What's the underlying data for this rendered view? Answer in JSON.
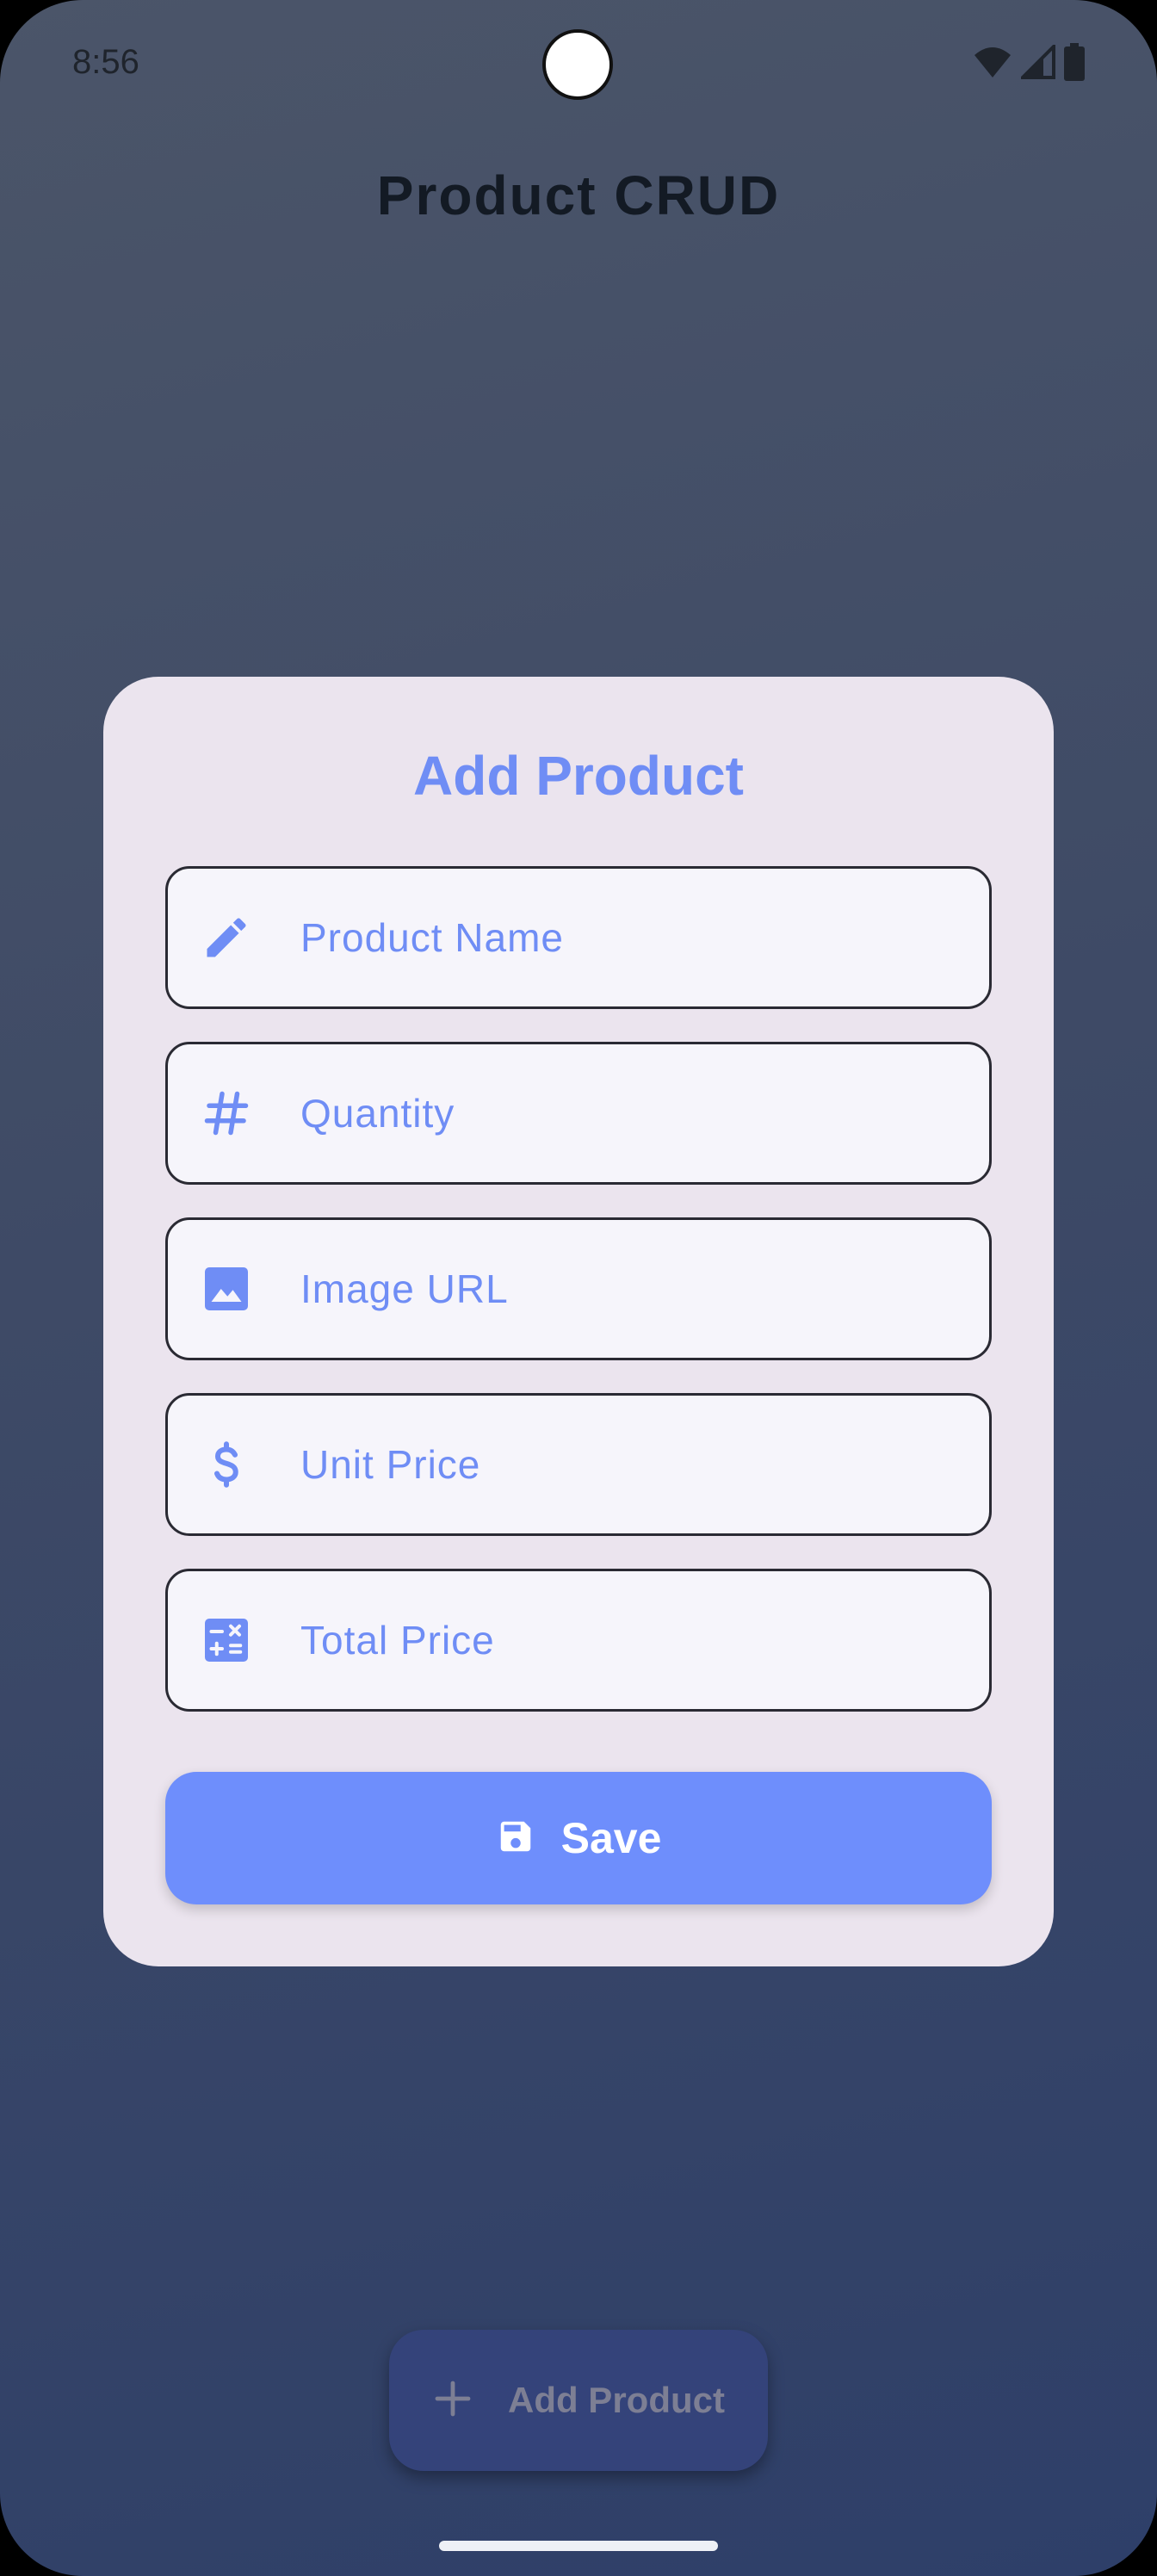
{
  "status_bar": {
    "time": "8:56",
    "icons": [
      "wifi-icon",
      "cellular-signal-icon",
      "battery-icon"
    ]
  },
  "app": {
    "title": "Product CRUD"
  },
  "dialog": {
    "title": "Add Product",
    "fields": [
      {
        "icon": "pencil-icon",
        "placeholder": "Product Name",
        "value": ""
      },
      {
        "icon": "hash-icon",
        "placeholder": "Quantity",
        "value": ""
      },
      {
        "icon": "image-icon",
        "placeholder": "Image URL",
        "value": ""
      },
      {
        "icon": "dollar-icon",
        "placeholder": "Unit Price",
        "value": ""
      },
      {
        "icon": "calculator-icon",
        "placeholder": "Total Price",
        "value": ""
      }
    ],
    "save_button": {
      "label": "Save",
      "icon": "save-icon"
    }
  },
  "fab": {
    "label": "Add Product",
    "icon": "plus-icon"
  },
  "colors": {
    "accent": "#6e8efc",
    "dialog_background": "#ebe4ee",
    "field_text": "#6f8df5",
    "fab_background": "#34437a"
  }
}
